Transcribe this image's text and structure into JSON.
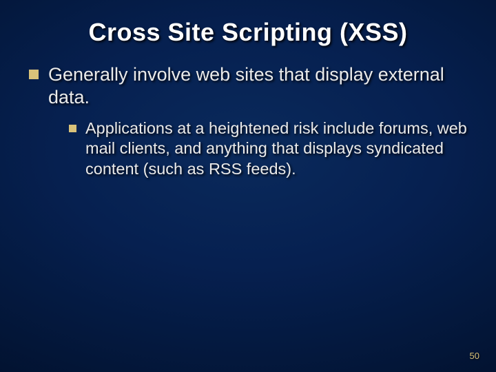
{
  "slide": {
    "title": "Cross Site Scripting (XSS)",
    "bullets": [
      {
        "text": "Generally involve web sites that display external data.",
        "children": [
          {
            "text": "Applications at a heightened risk include forums, web mail clients, and anything that displays syndicated content (such as RSS feeds)."
          }
        ]
      }
    ],
    "page_number": "50"
  }
}
